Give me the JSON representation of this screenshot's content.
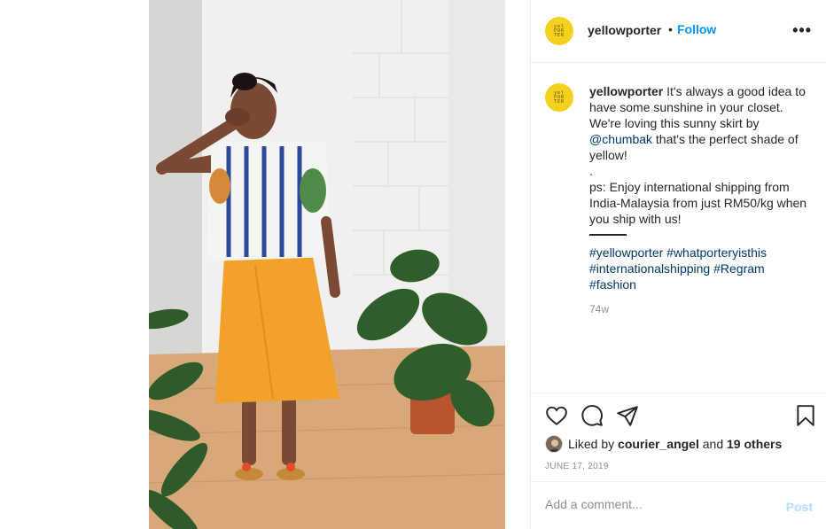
{
  "post": {
    "account": {
      "username": "yellowporter",
      "avatar_text": "yellow PORTER",
      "avatar_color": "#f5d11f"
    },
    "header": {
      "separator": "•",
      "follow_label": "Follow",
      "more_label": "•••"
    },
    "caption": {
      "username": "yellowporter",
      "text_1": " It's always a good idea to have some sunshine in your closet. We're loving this sunny skirt by ",
      "mention": "@chumbak",
      "text_2": " that's the perfect shade of yellow!",
      "dot": ".",
      "text_3": "ps: Enjoy international shipping from India-Malaysia from just RM50/kg when you ship with us!",
      "hashtags": [
        "#yellowporter",
        "#whatporteryisthis",
        "#internationalshipping",
        "#Regram",
        "#fashion"
      ],
      "time_ago": "74w"
    },
    "actions": {
      "icons": [
        "heart-icon",
        "comment-icon",
        "share-icon",
        "bookmark-icon"
      ]
    },
    "likes": {
      "prefix": "Liked by ",
      "user": "courier_angel",
      "middle": " and ",
      "others": "19 others"
    },
    "date": "JUNE 17, 2019",
    "comment": {
      "placeholder": "Add a comment...",
      "post_label": "Post"
    }
  },
  "colors": {
    "link": "#00376b",
    "follow": "#0095f6",
    "post_disabled": "#b2dffc",
    "muted": "#8e8e8e"
  }
}
